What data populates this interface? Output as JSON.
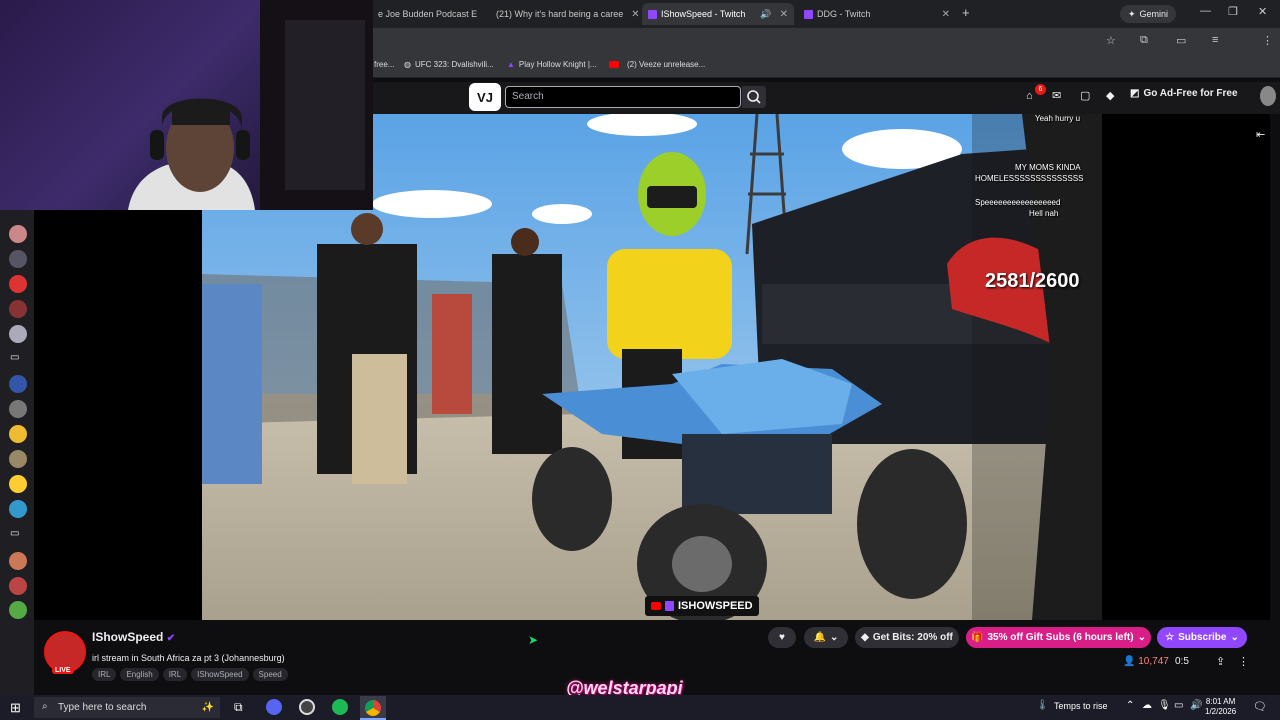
{
  "browser": {
    "tabs": [
      {
        "label": "e Joe Budden Podcast E",
        "icon": "podcast"
      },
      {
        "label": "(21) Why it's hard being a caree",
        "icon": "youtube"
      },
      {
        "label": "IShowSpeed - Twitch",
        "icon": "twitch",
        "active": true
      },
      {
        "label": "DDG - Twitch",
        "icon": "twitch"
      }
    ],
    "gemini_label": "Gemini",
    "bookmarks": [
      {
        "label": "free...",
        "icon": "folder"
      },
      {
        "label": "UFC 323: Dvalishvili...",
        "icon": "globe"
      },
      {
        "label": "Play Hollow Knight |...",
        "icon": "game"
      },
      {
        "label": "(2) Veeze unrelease...",
        "icon": "youtube"
      }
    ]
  },
  "twitch": {
    "search_placeholder": "Search",
    "notification_count": "6",
    "ad_free_label": "Go Ad-Free for Free",
    "stream_counter": "2581/2600",
    "chat_overlay": [
      "Yeah hurry u",
      "MY MOMS KINDA",
      "HOMELESSSSSSSSSSSSSS",
      "Speeeeeeeeeeeeeeeed",
      "Hell nah"
    ],
    "watermark": "ISHOWSPEED",
    "channel_name": "IShowSpeed",
    "live_badge": "LIVE",
    "stream_title": "irl stream in South Africa za pt 3 (Johannesburg)",
    "tags": [
      "IRL",
      "English",
      "IRL",
      "IShowSpeed",
      "Speed"
    ],
    "bits_label": "Get Bits: 20% off",
    "gift_subs_label": "35% off Gift Subs (6 hours left)",
    "subscribe_label": "Subscribe",
    "viewer_count": "10,747",
    "uptime": "0:5"
  },
  "overlay_handle": "@welstarpapi",
  "taskbar": {
    "search_placeholder": "Type here to search",
    "weather_label": "Temps to rise",
    "time": "8:01 AM",
    "date": "1/2/2026"
  },
  "colors": {
    "twitch_purple": "#9146ff",
    "live_red": "#e91916",
    "gift_pink": "#d91f87"
  }
}
